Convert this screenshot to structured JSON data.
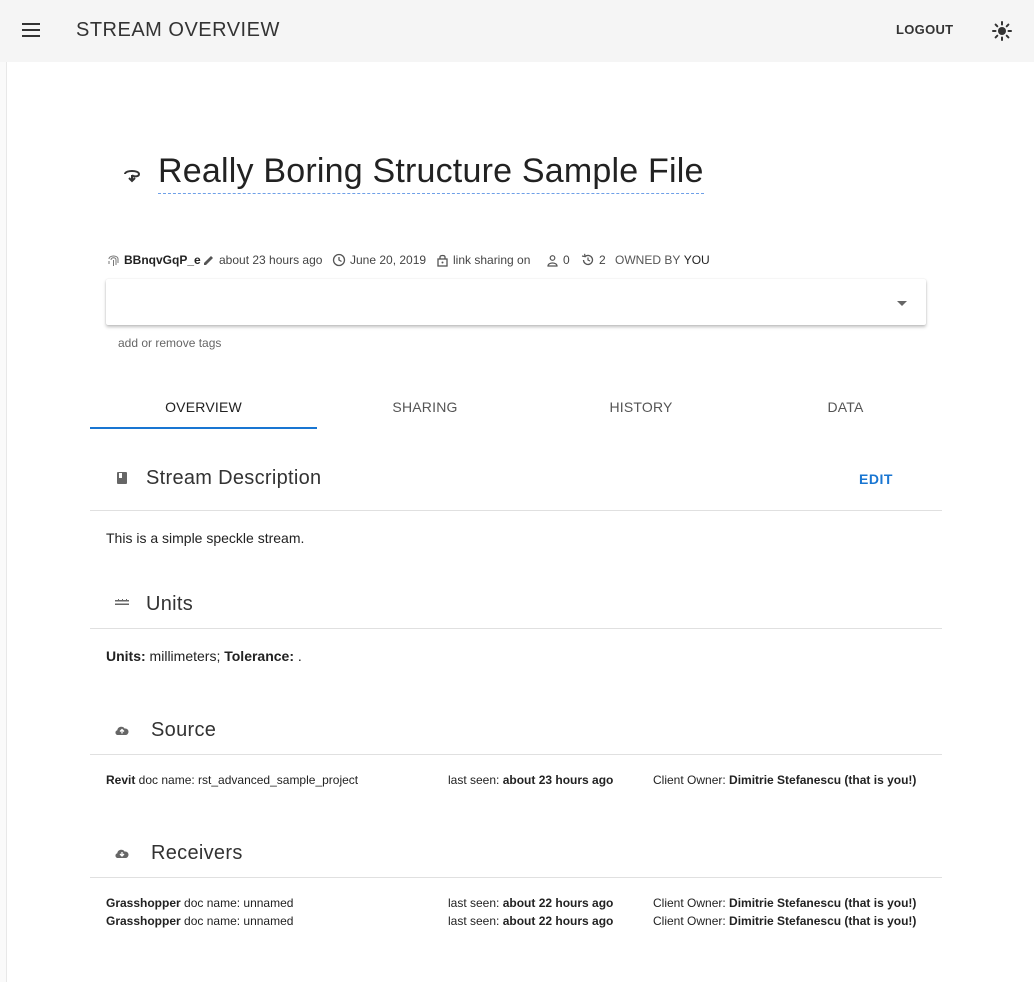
{
  "app": {
    "title": "STREAM OVERVIEW",
    "logout_label": "LOGOUT"
  },
  "stream": {
    "title": "Really Boring Structure Sample File",
    "id": "BBnqvGqP_e",
    "updated": "about 23 hours ago",
    "created": "June 20, 2019",
    "link_sharing": "link sharing on",
    "users_count": "0",
    "history_count": "2",
    "owned_by_label": "OWNED BY",
    "owner": "YOU"
  },
  "tags": {
    "hint": "add or remove tags"
  },
  "tabs": [
    {
      "label": "OVERVIEW"
    },
    {
      "label": "SHARING"
    },
    {
      "label": "HISTORY"
    },
    {
      "label": "DATA"
    }
  ],
  "description": {
    "heading": "Stream Description",
    "edit_label": "EDIT",
    "text": "This is a simple speckle stream."
  },
  "units": {
    "heading": "Units",
    "units_label": "Units:",
    "units_value": " millimeters; ",
    "tolerance_label": "Tolerance:",
    "tolerance_value": " ."
  },
  "source": {
    "heading": "Source",
    "rows": [
      {
        "client": "Revit",
        "doc": " doc name: rst_advanced_sample_project",
        "seen_label": "last seen: ",
        "seen": "about 23 hours ago",
        "owner_label": "Client Owner: ",
        "owner": "Dimitrie Stefanescu (that is you!)"
      }
    ]
  },
  "receivers": {
    "heading": "Receivers",
    "rows": [
      {
        "client": "Grasshopper",
        "doc": " doc name: unnamed",
        "seen_label": "last seen: ",
        "seen": "about 22 hours ago",
        "owner_label": "Client Owner: ",
        "owner": "Dimitrie Stefanescu (that is you!)"
      },
      {
        "client": "Grasshopper",
        "doc": " doc name: unnamed",
        "seen_label": "last seen: ",
        "seen": "about 22 hours ago",
        "owner_label": "Client Owner: ",
        "owner": "Dimitrie Stefanescu (that is you!)"
      }
    ]
  },
  "colors": {
    "accent": "#1976d2",
    "title_underline": "#6ea0e8"
  },
  "icons": [
    "menu-icon",
    "sun-icon",
    "stream-icon",
    "fingerprint-icon",
    "pencil-icon",
    "clock-icon",
    "lock-icon",
    "person-icon",
    "history-icon",
    "book-icon",
    "ruler-icon",
    "cloud-upload-icon",
    "cloud-download-icon"
  ]
}
